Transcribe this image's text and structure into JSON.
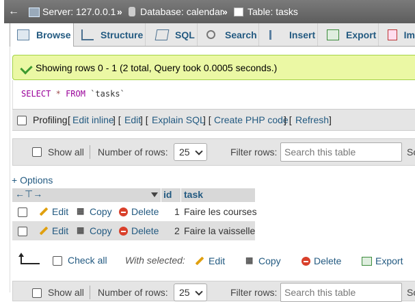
{
  "breadcrumb": {
    "server": "Server: 127.0.0.1",
    "database": "Database: calendar",
    "table": "Table: tasks",
    "separator": "»"
  },
  "tabs": [
    {
      "label": "Browse",
      "icon": "browse-icon"
    },
    {
      "label": "Structure",
      "icon": "structure-icon"
    },
    {
      "label": "SQL",
      "icon": "sql-icon"
    },
    {
      "label": "Search",
      "icon": "search-icon"
    },
    {
      "label": "Insert",
      "icon": "insert-icon"
    },
    {
      "label": "Export",
      "icon": "export-icon"
    },
    {
      "label": "Im",
      "icon": "import-icon"
    }
  ],
  "message": {
    "text": "Showing rows 0 - 1 (2 total, Query took 0.0005 seconds.)"
  },
  "sql": {
    "select": "SELECT",
    "star": "*",
    "from": "FROM",
    "table": "`tasks`"
  },
  "profiling": {
    "label": "Profiling",
    "open": "[",
    "close": "]",
    "sep": "] [",
    "links": [
      "Edit inline",
      "Edit",
      "Explain SQL",
      "Create PHP code",
      "Refresh"
    ]
  },
  "nav": {
    "show_all": "Show all",
    "rows_label": "Number of rows:",
    "rows_value": "25",
    "filter_label": "Filter rows:",
    "filter_placeholder": "Search this table",
    "sort_cut": "So"
  },
  "options_link": "+ Options",
  "table": {
    "columns": [
      "id",
      "task"
    ],
    "rows": [
      {
        "id": "1",
        "task": "Faire les courses"
      },
      {
        "id": "2",
        "task": "Faire la vaisselle"
      }
    ],
    "actions": {
      "edit": "Edit",
      "copy": "Copy",
      "delete": "Delete"
    }
  },
  "bulk": {
    "check_all": "Check all",
    "with_selected": "With selected:",
    "edit": "Edit",
    "copy": "Copy",
    "delete": "Delete",
    "export": "Export"
  },
  "colors": {
    "link": "#235a81",
    "success_bg": "#ebf8a4",
    "success_border": "#a2d246",
    "topbar": "#6b6b6b"
  }
}
